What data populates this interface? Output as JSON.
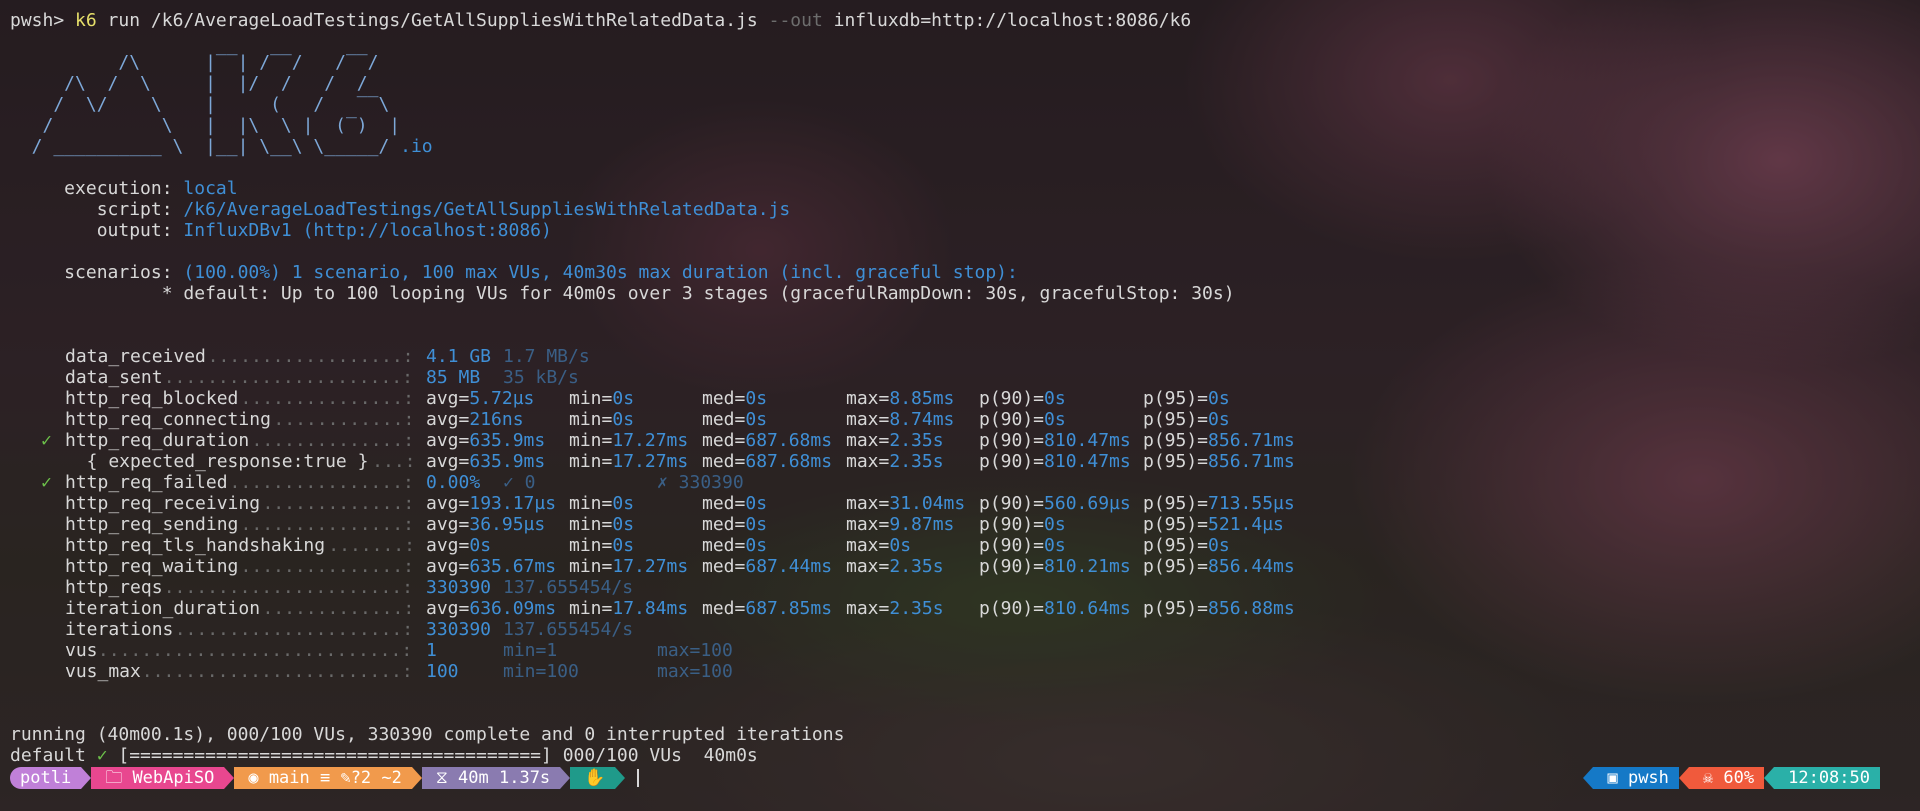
{
  "prompt": {
    "shell": "pwsh>",
    "cmd": "k6",
    "args": " run /k6/AverageLoadTestings/GetAllSuppliesWithRelatedData.js ",
    "flag": "--out",
    "out": " influxdb=http://localhost:8086/k6"
  },
  "logo": [
    "          /\\      |‾‾| /‾‾/   /‾‾/",
    "     /\\  /  \\     |  |/  /   /  /",
    "    /  \\/    \\    |     (   /   ‾‾\\",
    "   /          \\   |  |\\  \\ |  (‾)  |",
    "  / __________ \\  |__| \\__\\ \\_____/"
  ],
  "logo_suffix": " .io",
  "info": {
    "execution_label": "     execution: ",
    "execution": "local",
    "script_label": "        script: ",
    "script": "/k6/AverageLoadTestings/GetAllSuppliesWithRelatedData.js",
    "output_label": "        output: ",
    "output": "InfluxDBv1 (http://localhost:8086)",
    "scenarios_label": "     scenarios: ",
    "scenarios": "(100.00%) 1 scenario, 100 max VUs, 40m30s max duration (incl. graceful stop):",
    "default_line": "              * default: Up to 100 looping VUs for 40m0s over 3 stages (gracefulRampDown: 30s, gracefulStop: 30s)"
  },
  "metrics": [
    {
      "check": "",
      "name": "data_received",
      "dots": "..................",
      "v1": "4.1 GB",
      "rate": "1.7 MB/s"
    },
    {
      "check": "",
      "name": "data_sent",
      "dots": "......................",
      "v1": "85 MB",
      "rate": "35 kB/s"
    },
    {
      "check": "",
      "name": "http_req_blocked",
      "dots": "...............",
      "avg": "5.72µs",
      "min": "0s",
      "med": "0s",
      "max": "8.85ms",
      "p90": "0s",
      "p95": "0s"
    },
    {
      "check": "",
      "name": "http_req_connecting",
      "dots": "............",
      "avg": "216ns",
      "min": "0s",
      "med": "0s",
      "max": "8.74ms",
      "p90": "0s",
      "p95": "0s"
    },
    {
      "check": "✓",
      "name": "http_req_duration",
      "dots": "..............",
      "avg": "635.9ms",
      "min": "17.27ms",
      "med": "687.68ms",
      "max": "2.35s",
      "p90": "810.47ms",
      "p95": "856.71ms"
    },
    {
      "check": "",
      "name": "  { expected_response:true }",
      "dots": "...",
      "avg": "635.9ms",
      "min": "17.27ms",
      "med": "687.68ms",
      "max": "2.35s",
      "p90": "810.47ms",
      "p95": "856.71ms"
    },
    {
      "check": "✓",
      "name": "http_req_failed",
      "dots": "................",
      "v1": "0.00%",
      "rate": "✓ 0",
      "extra": "✗ 330390"
    },
    {
      "check": "",
      "name": "http_req_receiving",
      "dots": ".............",
      "avg": "193.17µs",
      "min": "0s",
      "med": "0s",
      "max": "31.04ms",
      "p90": "560.69µs",
      "p95": "713.55µs"
    },
    {
      "check": "",
      "name": "http_req_sending",
      "dots": "...............",
      "avg": "36.95µs",
      "min": "0s",
      "med": "0s",
      "max": "9.87ms",
      "p90": "0s",
      "p95": "521.4µs"
    },
    {
      "check": "",
      "name": "http_req_tls_handshaking",
      "dots": ".......",
      "avg": "0s",
      "min": "0s",
      "med": "0s",
      "max": "0s",
      "p90": "0s",
      "p95": "0s"
    },
    {
      "check": "",
      "name": "http_req_waiting",
      "dots": "...............",
      "avg": "635.67ms",
      "min": "17.27ms",
      "med": "687.44ms",
      "max": "2.35s",
      "p90": "810.21ms",
      "p95": "856.44ms"
    },
    {
      "check": "",
      "name": "http_reqs",
      "dots": "......................",
      "v1": "330390",
      "rate": "137.655454/s"
    },
    {
      "check": "",
      "name": "iteration_duration",
      "dots": ".............",
      "avg": "636.09ms",
      "min": "17.84ms",
      "med": "687.85ms",
      "max": "2.35s",
      "p90": "810.64ms",
      "p95": "856.88ms"
    },
    {
      "check": "",
      "name": "iterations",
      "dots": ".....................",
      "v1": "330390",
      "rate": "137.655454/s"
    },
    {
      "check": "",
      "name": "vus",
      "dots": "............................",
      "v1": "1",
      "rate": "min=1",
      "extra": "max=100"
    },
    {
      "check": "",
      "name": "vus_max",
      "dots": "........................",
      "v1": "100",
      "rate": "min=100",
      "extra": "max=100"
    }
  ],
  "footer": {
    "running": "running (40m00.1s), 000/100 VUs, 330390 complete and 0 interrupted iterations",
    "default_label": "default ",
    "default_check": "✓",
    "bar": " [======================================] 000/100 VUs  40m0s"
  },
  "statusbar": {
    "segments": [
      {
        "text": "potli",
        "color": "#c080d8"
      },
      {
        "icon": "folder-icon",
        "text": "WebApiSO",
        "color": "#e8478f"
      },
      {
        "icon": "github-icon",
        "text": "main ≡ ✎?2 ~2",
        "color": "#f19a4c"
      },
      {
        "icon": "timer-icon",
        "text": "40m 1.37s",
        "color": "#8a7bb0"
      },
      {
        "icon": "hand-icon",
        "text": "",
        "color": "#1f9a8a"
      }
    ],
    "right": [
      {
        "icon": "terminal-icon",
        "text": "pwsh",
        "color": "#1579c7"
      },
      {
        "icon": "skull-icon",
        "text": "60%",
        "color": "#f05a3c"
      },
      {
        "text": "12:08:50",
        "color": "#2ab0a8"
      }
    ]
  },
  "colors": {
    "accent": "#3f8fd6",
    "command": "#e6df6a",
    "check": "#6cc04a"
  }
}
